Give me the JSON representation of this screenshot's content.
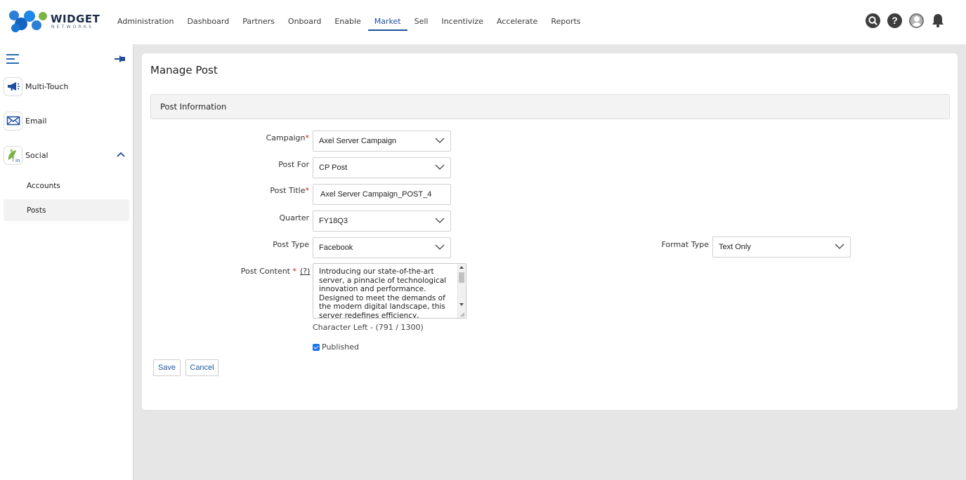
{
  "app": {
    "brand_name": "WIDGET",
    "brand_sub": "NETWORKS"
  },
  "nav": {
    "items": [
      {
        "label": "Administration"
      },
      {
        "label": "Dashboard"
      },
      {
        "label": "Partners"
      },
      {
        "label": "Onboard"
      },
      {
        "label": "Enable"
      },
      {
        "label": "Market",
        "active": true
      },
      {
        "label": "Sell"
      },
      {
        "label": "Incentivize"
      },
      {
        "label": "Accelerate"
      },
      {
        "label": "Reports"
      }
    ]
  },
  "top_icons": {
    "search": "search-icon",
    "help_glyph": "?",
    "avatar": "avatar",
    "notifications": "bell-icon"
  },
  "sidebar": {
    "items": [
      {
        "label": "Multi-Touch",
        "icon": "megaphone-icon"
      },
      {
        "label": "Email",
        "icon": "envelope-icon"
      },
      {
        "label": "Social",
        "icon": "social-icon",
        "expanded": true
      }
    ],
    "sub_items": [
      {
        "label": "Accounts"
      },
      {
        "label": "Posts",
        "active": true
      }
    ]
  },
  "page": {
    "title": "Manage Post",
    "section": "Post Information"
  },
  "form": {
    "campaign": {
      "label": "Campaign",
      "required_mark": "*",
      "value": "Axel Server Campaign"
    },
    "post_for": {
      "label": "Post For",
      "value": "CP Post"
    },
    "post_title": {
      "label": "Post Title",
      "required_mark": "*",
      "value": "Axel Server Campaign_POST_4"
    },
    "quarter": {
      "label": "Quarter",
      "value": "FY18Q3"
    },
    "post_type": {
      "label": "Post Type",
      "value": "Facebook"
    },
    "format_type": {
      "label": "Format Type",
      "value": "Text Only"
    },
    "post_content": {
      "label": "Post Content",
      "required_mark": "*",
      "help": "(?)",
      "value": "Introducing our state-of-the-art server, a pinnacle of technological innovation and performance. Designed to meet the demands of the modern digital landscape, this server redefines efficiency, reliability,"
    },
    "char_left": "Character Left - (791 / 1300)",
    "published": {
      "label": "Published",
      "checked": true
    },
    "save_label": "Save",
    "cancel_label": "Cancel"
  },
  "colors": {
    "accent": "#1f4e9c",
    "required": "#d01919",
    "link": "#1f5aa8",
    "checkbox": "#1a73e8"
  }
}
